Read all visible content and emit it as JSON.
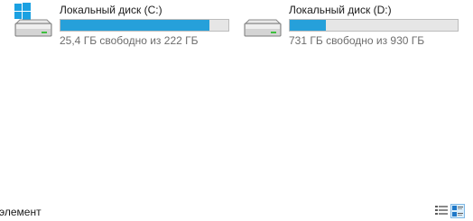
{
  "drives": [
    {
      "name": "Локальный диск (C:)",
      "free_text": "25,4 ГБ свободно из 222 ГБ",
      "used_fraction": 0.886,
      "icon": "windows-drive-icon",
      "bar_color": "#26a0da"
    },
    {
      "name": "Локальный диск (D:)",
      "free_text": "731 ГБ свободно из 930 ГБ",
      "used_fraction": 0.214,
      "icon": "hard-drive-icon",
      "bar_color": "#26a0da"
    }
  ],
  "statusbar": {
    "text": "элемент",
    "views": [
      {
        "name": "details-view",
        "icon": "details-view-icon",
        "active": false
      },
      {
        "name": "tiles-view",
        "icon": "tiles-view-icon",
        "active": true
      }
    ]
  }
}
